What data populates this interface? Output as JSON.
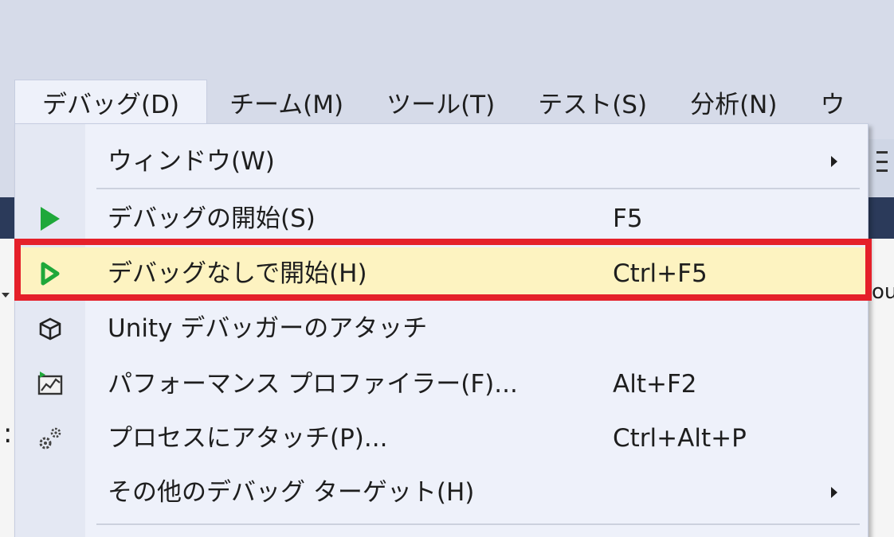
{
  "menubar": {
    "items": [
      {
        "label": "デバッグ(D)",
        "active": true
      },
      {
        "label": "チーム(M)"
      },
      {
        "label": "ツール(T)"
      },
      {
        "label": "テスト(S)"
      },
      {
        "label": "分析(N)"
      },
      {
        "label": "ウ"
      }
    ]
  },
  "debug_menu": {
    "items": [
      {
        "label": "ウィンドウ(W)",
        "submenu": true
      },
      {
        "label": "デバッグの開始(S)",
        "shortcut": "F5",
        "icon": "play-icon"
      },
      {
        "label": "デバッグなしで開始(H)",
        "shortcut": "Ctrl+F5",
        "icon": "play-outline-icon",
        "highlighted": true
      },
      {
        "label": "Unity デバッガーのアタッチ",
        "icon": "unity-cube-icon"
      },
      {
        "label": "パフォーマンス プロファイラー(F)...",
        "shortcut": "Alt+F2",
        "icon": "performance-profiler-icon"
      },
      {
        "label": "プロセスにアタッチ(P)...",
        "shortcut": "Ctrl+Alt+P",
        "icon": "gears-icon"
      },
      {
        "label": "その他のデバッグ ターゲット(H)",
        "submenu": true
      }
    ]
  },
  "background": {
    "right_text": "ou",
    "colon": ":"
  },
  "colors": {
    "highlight_fill": "#fdf3c1",
    "annotation_border": "#e5202a",
    "play_green": "#1fa83a",
    "menu_bg": "#eef1fa"
  }
}
